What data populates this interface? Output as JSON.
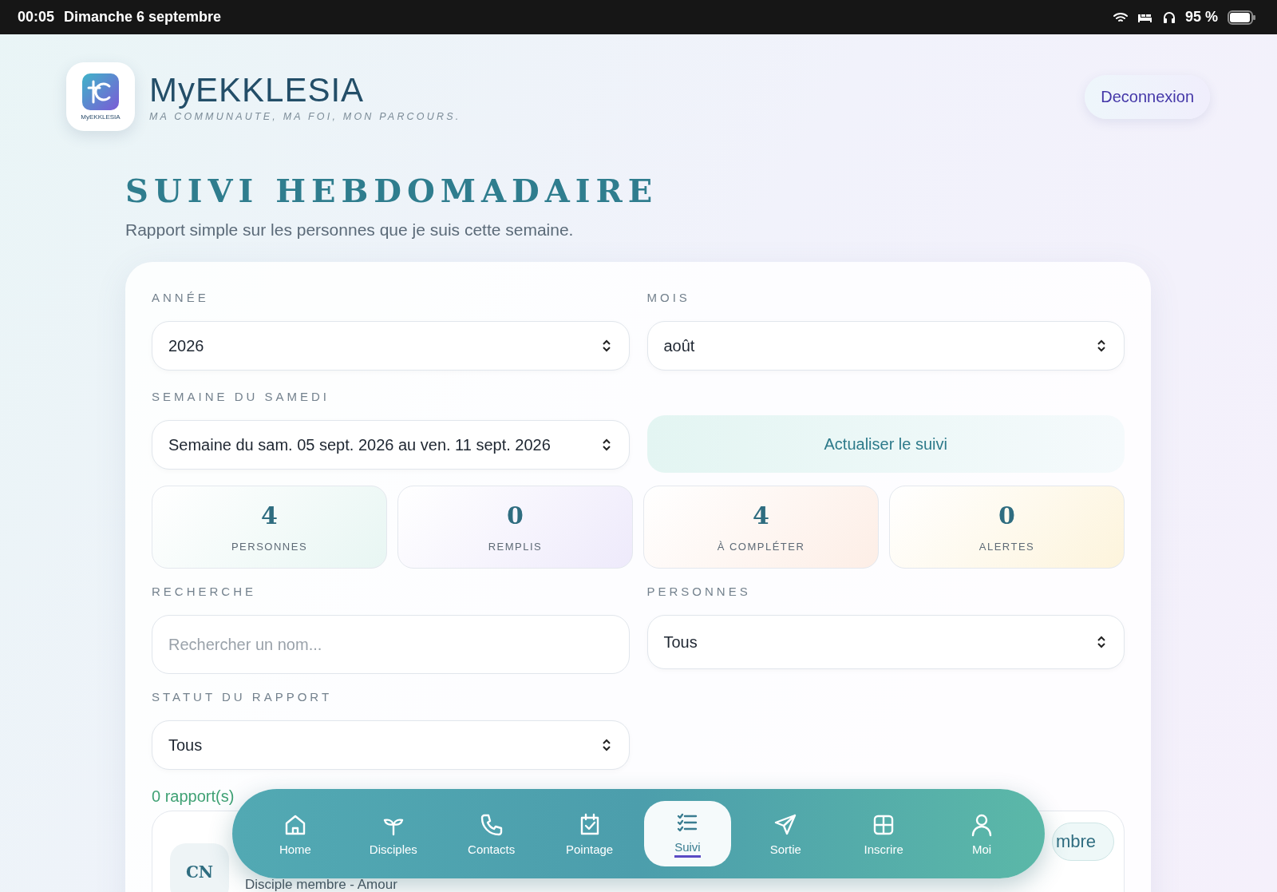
{
  "status_bar": {
    "time": "00:05",
    "date": "Dimanche 6 septembre",
    "battery": "95 %"
  },
  "header": {
    "logo_text": "MyEKKLESIA",
    "title": "MyEKKLESIA",
    "tagline": "MA COMMUNAUTE, MA FOI, MON PARCOURS.",
    "logout": "Deconnexion"
  },
  "page": {
    "title": "SUIVI HEBDOMADAIRE",
    "subtitle": "Rapport simple sur les personnes que je suis cette semaine."
  },
  "filters": {
    "year": {
      "label": "ANNÉE",
      "value": "2026"
    },
    "month": {
      "label": "MOIS",
      "value": "août"
    },
    "week": {
      "label": "SEMAINE DU SAMEDI",
      "value": "Semaine du sam. 05 sept. 2026 au ven. 11 sept. 2026"
    },
    "refresh": "Actualiser le suivi"
  },
  "stats": [
    {
      "value": "4",
      "label": "PERSONNES",
      "color": "#e8f6f3"
    },
    {
      "value": "0",
      "label": "REMPLIS",
      "color": "#eeeafb"
    },
    {
      "value": "4",
      "label": "À COMPLÉTER",
      "color": "#fdeee6"
    },
    {
      "value": "0",
      "label": "ALERTES",
      "color": "#fdf4dc"
    }
  ],
  "search": {
    "label": "RECHERCHE",
    "placeholder": "Rechercher un nom..."
  },
  "persons": {
    "label": "PERSONNES",
    "value": "Tous"
  },
  "report_status": {
    "label": "STATUT DU RAPPORT",
    "value": "Tous"
  },
  "count": "0 rapport(s)",
  "list": [
    {
      "initials": "CN",
      "subtitle": "Disciple membre - Amour",
      "action": "mbre"
    }
  ],
  "nav": [
    {
      "label": "Home",
      "selected": false
    },
    {
      "label": "Disciples",
      "selected": false
    },
    {
      "label": "Contacts",
      "selected": false
    },
    {
      "label": "Pointage",
      "selected": false
    },
    {
      "label": "Suivi",
      "selected": true
    },
    {
      "label": "Sortie",
      "selected": false
    },
    {
      "label": "Inscrire",
      "selected": false
    },
    {
      "label": "Moi",
      "selected": false
    }
  ]
}
